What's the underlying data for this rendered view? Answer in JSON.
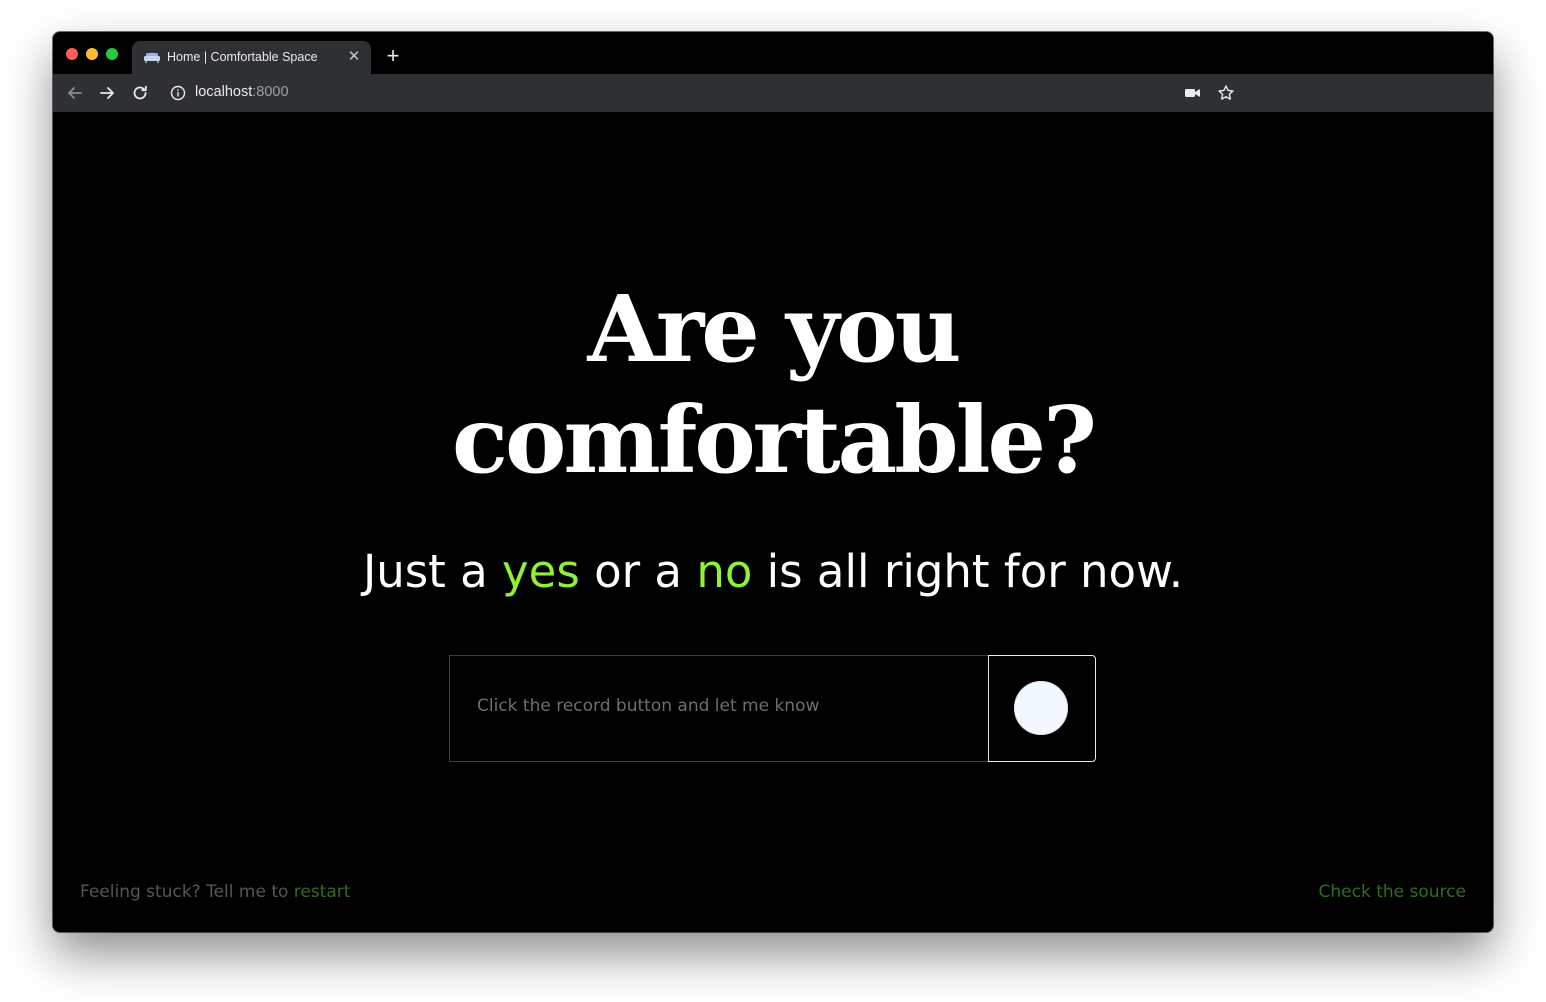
{
  "browser": {
    "tab_title": "Home | Comfortable Space",
    "url_host": "localhost",
    "url_port": ":8000",
    "icons": {
      "favicon": "couch-favicon-icon",
      "tab_close": "close-icon",
      "new_tab": "plus-icon",
      "back": "arrow-left-icon",
      "forward": "arrow-right-icon",
      "reload": "reload-icon",
      "site_info": "info-icon",
      "camera": "video-camera-icon",
      "bookmark": "star-icon"
    },
    "glyphs": {
      "tab_close": "✕",
      "new_tab": "+"
    }
  },
  "page": {
    "headline_line1": "Are you",
    "headline_line2": "comfortable?",
    "subline": {
      "part1": "Just a ",
      "yes": "yes",
      "part2": " or a ",
      "no": "no",
      "part3": " is all right for now."
    },
    "input": {
      "placeholder": "Click the record button and let me know",
      "value": ""
    },
    "record_button_icon": "record-icon",
    "footer": {
      "left_text": "Feeling stuck? Tell me to ",
      "restart_link": "restart",
      "source_link": "Check the source"
    },
    "colors": {
      "background": "#000000",
      "accent": "#8ef334",
      "footer_link": "#2f6d1e",
      "footer_text": "#575757"
    }
  }
}
